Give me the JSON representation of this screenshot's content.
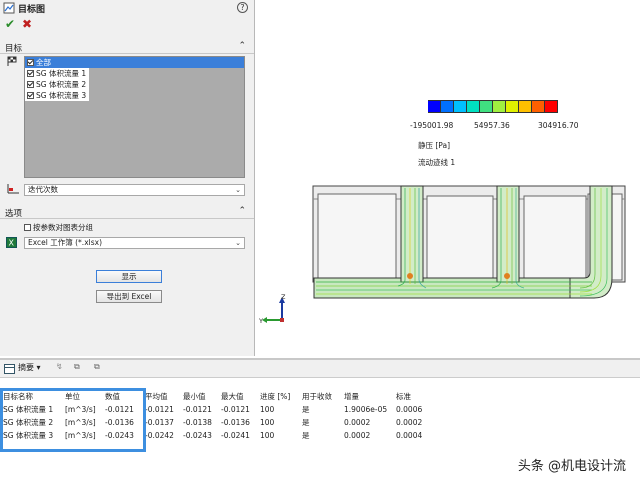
{
  "panel": {
    "title": "目标图",
    "help_icon": "?",
    "targets_section": "目标",
    "target_items": [
      {
        "label": "全部",
        "checked": true,
        "selected": true
      },
      {
        "label": "SG 体积流量 1",
        "checked": true,
        "selected": false
      },
      {
        "label": "SG 体积流量 2",
        "checked": true,
        "selected": false
      },
      {
        "label": "SG 体积流量 3",
        "checked": true,
        "selected": false
      }
    ],
    "x_axis_dropdown": "迭代次数",
    "options_section": "选项",
    "group_checkbox": "按参数对图表分组",
    "export_format_dropdown": "Excel 工作簿 (*.xlsx)",
    "show_button": "显示",
    "export_button": "导出到 Excel"
  },
  "view": {
    "legend_min": "-195001.98",
    "legend_mid": "54957.36",
    "legend_max": "304916.70",
    "legend_colors": [
      "#0000ff",
      "#0070ff",
      "#00c0ff",
      "#00e0c0",
      "#40e080",
      "#a0f040",
      "#e0f000",
      "#ffc000",
      "#ff6000",
      "#ff0000"
    ],
    "legend_title": "静压 [Pa]",
    "legend_subtitle": "流动迹线 1",
    "triad_y": "Y",
    "triad_z": "Z"
  },
  "table": {
    "toolbar_summary": "摘要",
    "columns": [
      "目标名称",
      "单位",
      "数值",
      "平均值",
      "最小值",
      "最大值",
      "进度 [%]",
      "用于收敛",
      "增量",
      "标准"
    ],
    "rows": [
      [
        "SG 体积流量 1",
        "[m^3/s]",
        "-0.0121",
        "-0.0121",
        "-0.0121",
        "-0.0121",
        "100",
        "是",
        "1.9006e-05",
        "0.0006"
      ],
      [
        "SG 体积流量 2",
        "[m^3/s]",
        "-0.0136",
        "-0.0137",
        "-0.0138",
        "-0.0136",
        "100",
        "是",
        "0.0002",
        "0.0002"
      ],
      [
        "SG 体积流量 3",
        "[m^3/s]",
        "-0.0243",
        "-0.0242",
        "-0.0243",
        "-0.0241",
        "100",
        "是",
        "0.0002",
        "0.0004"
      ]
    ]
  },
  "watermark": "头条 @机电设计流"
}
